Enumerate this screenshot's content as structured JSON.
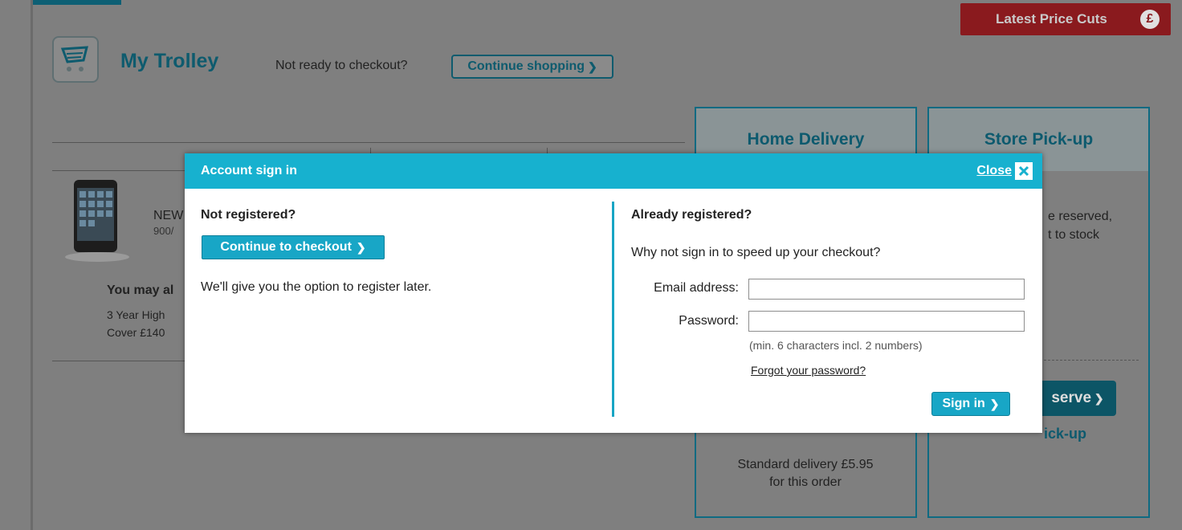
{
  "header": {
    "title": "My Trolley",
    "not_ready_text": "Not ready to checkout?",
    "continue_shopping_label": "Continue shopping",
    "price_cuts_label": "Latest Price Cuts",
    "price_cuts_symbol": "£"
  },
  "product": {
    "name_fragment": "NEW",
    "code_fragment": "900/",
    "may_also_label": "You may al",
    "warranty_line1": "3 Year High",
    "warranty_line2": "Cover £140"
  },
  "delivery": {
    "home_title": "Home Delivery",
    "store_title": "Store Pick-up",
    "store_line1": "e reserved,",
    "store_line2": "t to stock",
    "reserve_label": "serve",
    "pickup_text": "ick-up",
    "standard_line1": "Standard delivery £5.95",
    "standard_line2": "for this order"
  },
  "modal": {
    "title": "Account sign in",
    "close_label": "Close",
    "not_registered_heading": "Not registered?",
    "continue_checkout_label": "Continue to checkout",
    "register_later_text": "We'll give you the option to register later.",
    "already_registered_heading": "Already registered?",
    "speed_up_text": "Why not sign in to speed up your checkout?",
    "email_label": "Email address:",
    "email_value": "",
    "password_label": "Password:",
    "password_value": "",
    "password_hint": "(min. 6 characters incl. 2 numbers)",
    "forgot_label": "Forgot your password?",
    "sign_in_label": "Sign in"
  },
  "colors": {
    "modal_header": "#17b1cf",
    "button": "#18a6c6",
    "price_cuts": "#8a1a1e"
  }
}
